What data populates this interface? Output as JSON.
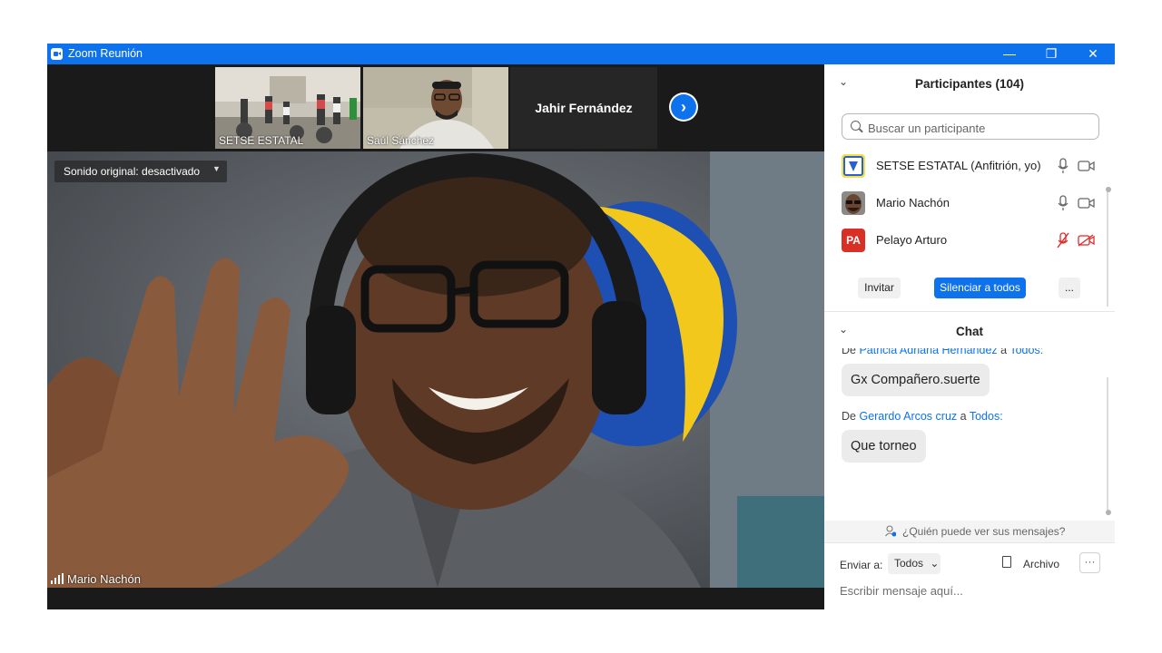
{
  "window": {
    "title": "Zoom Reunión"
  },
  "window_controls": {
    "minimize": "—",
    "restore": "❐",
    "close": "✕"
  },
  "gallery": {
    "thumbnails": [
      {
        "name": "SETSE ESTATAL"
      },
      {
        "name": "Saúl Sánchez"
      },
      {
        "name": "Jahir Fernández"
      }
    ],
    "next_glyph": "›"
  },
  "main_video": {
    "audio_label": "Sonido original: desactivado",
    "audio_caret": "▼",
    "speaker": "Mario Nachón"
  },
  "participants": {
    "title": "Participantes (104)",
    "collapse_glyph": "⌄",
    "search_placeholder": "Buscar un participante",
    "list": [
      {
        "name": "SETSE ESTATAL (Anfitrión, yo)",
        "muted": false,
        "video_off": false,
        "avatar": "logo"
      },
      {
        "name": "Mario Nachón",
        "muted": false,
        "video_off": false,
        "avatar": "photo"
      },
      {
        "name": "Pelayo Arturo",
        "muted": true,
        "video_off": true,
        "avatar": "initials",
        "initials": "PA",
        "avatar_color": "#d93025"
      }
    ],
    "buttons": {
      "invite": "Invitar",
      "mute_all": "Silenciar a todos",
      "more": "..."
    }
  },
  "chat": {
    "title": "Chat",
    "collapse_glyph": "⌄",
    "messages": [
      {
        "prefix": "De",
        "from": "Patricia Adriana Hernández",
        "to_word": "a",
        "to": "Todos:",
        "text": "Gx Compañero.suerte"
      },
      {
        "prefix": "De",
        "from": "Gerardo Arcos cruz",
        "to_word": "a",
        "to": "Todos:",
        "text": "Que torneo"
      }
    ],
    "who_can_see": "¿Quién puede ver sus mensajes?",
    "send_to_label": "Enviar a:",
    "send_to_value": "Todos",
    "send_to_caret": "⌄",
    "file_label": "Archivo",
    "more": "···",
    "input_placeholder": "Escribir mensaje aquí..."
  },
  "colors": {
    "accent": "#0e72ed",
    "title_bar": "#0e72ed",
    "muted_red": "#e02828",
    "video_bg": "#1a1a1a"
  }
}
